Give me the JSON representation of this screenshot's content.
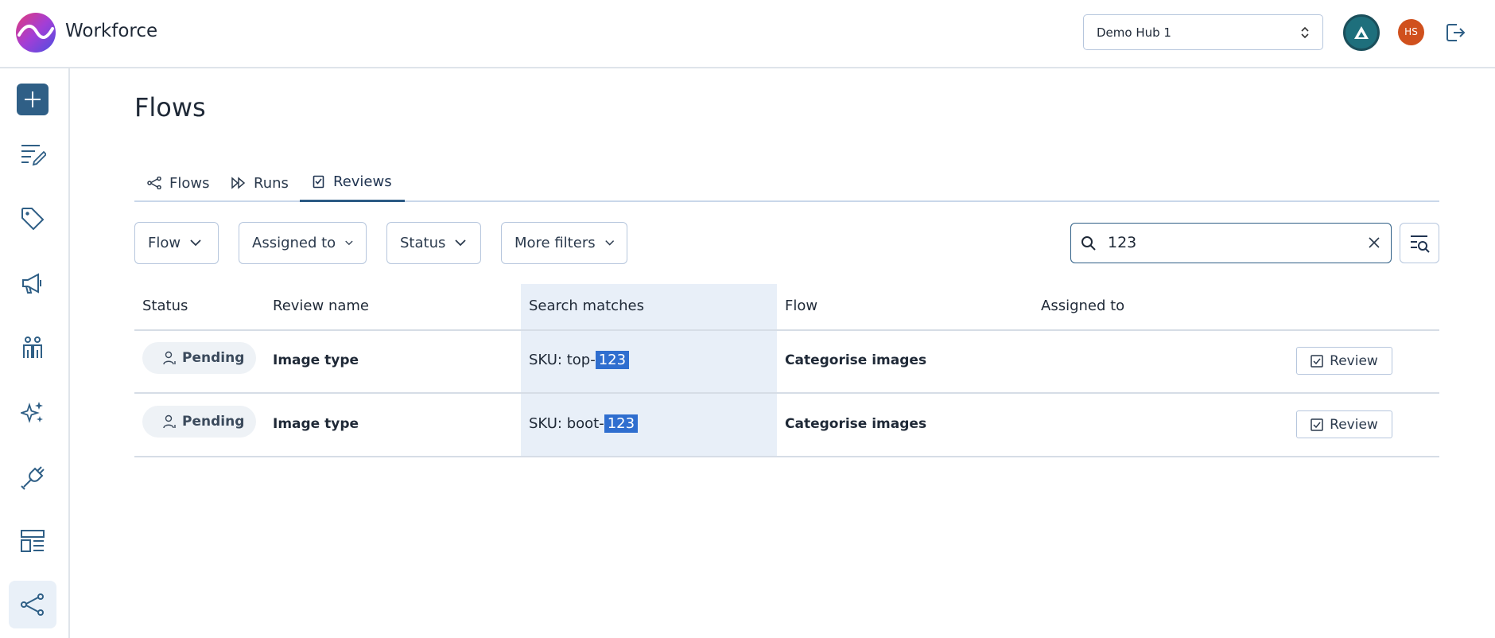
{
  "app": {
    "name": "Workforce"
  },
  "header": {
    "hub_select_value": "Demo Hub 1",
    "user_initials": "HS"
  },
  "sidebar": {
    "items": [
      {
        "icon": "plus-icon"
      },
      {
        "icon": "edit-list-icon"
      },
      {
        "icon": "tag-icon"
      },
      {
        "icon": "megaphone-icon"
      },
      {
        "icon": "people-icon"
      },
      {
        "icon": "sparkles-icon"
      },
      {
        "icon": "plug-icon"
      },
      {
        "icon": "layout-icon"
      },
      {
        "icon": "flow-icon",
        "active": true
      }
    ]
  },
  "page": {
    "title": "Flows"
  },
  "tabs": [
    {
      "label": "Flows",
      "icon": "flow-icon"
    },
    {
      "label": "Runs",
      "icon": "fast-forward-icon"
    },
    {
      "label": "Reviews",
      "icon": "review-icon",
      "active": true
    }
  ],
  "filters": {
    "flow": "Flow",
    "assigned_to": "Assigned to",
    "status": "Status",
    "more": "More filters"
  },
  "search": {
    "value": "123"
  },
  "table": {
    "columns": [
      "Status",
      "Review name",
      "Search matches",
      "Flow",
      "Assigned to"
    ],
    "rows": [
      {
        "status": "Pending",
        "review_name": "Image type",
        "match_prefix": "SKU: top-",
        "match_hit": "123",
        "flow": "Categorise images",
        "assigned_to": "",
        "action": "Review"
      },
      {
        "status": "Pending",
        "review_name": "Image type",
        "match_prefix": "SKU: boot-",
        "match_hit": "123",
        "flow": "Categorise images",
        "assigned_to": "",
        "action": "Review"
      }
    ]
  },
  "colors": {
    "accent": "#2f5f86",
    "match_highlight": "#2f6ecf",
    "highlight_column": "#e8eff8",
    "user_avatar": "#d0501d"
  }
}
